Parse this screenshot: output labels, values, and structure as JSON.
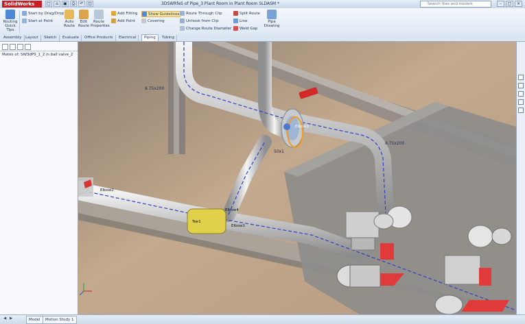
{
  "app": {
    "logo": "SolidWorks",
    "doc_title": "3DSWRfeS of Pipe_3 Plant Room in Plant Room SLDASM *"
  },
  "search": {
    "placeholder": "Search files and models"
  },
  "window_buttons": [
    "–",
    "□",
    "×"
  ],
  "ribbon": {
    "routing_quick_tips": "Routing Quick Tips",
    "start_by_drag_drop": "Start by Drag/Drop",
    "start_at_point": "Start at Point",
    "auto_route": "Auto Route",
    "edit_route": "Edit Route",
    "route_properties": "Route Properties",
    "add_fitting": "Add Fitting",
    "add_point": "Add Point",
    "show_guidelines": "Show Guidelines",
    "covering": "Covering",
    "route_through_clip": "Route Through Clip",
    "unhook_from_clip": "Unhook from Clip",
    "change_route_diameter": "Change Route Diameter",
    "split_route": "Split Route",
    "line": "Line",
    "weld_gap": "Weld Gap",
    "pipe_drawing": "Pipe Drawing"
  },
  "tabs": [
    "Assembly",
    "Layout",
    "Sketch",
    "Evaluate",
    "Office Products",
    "Electrical",
    "Piping",
    "Tubing"
  ],
  "active_tab": "Piping",
  "side_panel": {
    "mate_title": "Mates of: SW3dPS_1_2 in ball valve_2"
  },
  "viewport_labels": {
    "dim1": "8.75x200",
    "dim2": "8.75x200",
    "dim3": "50x1",
    "node1": "Elbow1",
    "node2": "Elbow2",
    "node3": "Elbow3",
    "node4": "Elbow4",
    "tee": "Tee1"
  },
  "statusbar": {
    "model": "Model",
    "motion": "Motion Study 1"
  }
}
